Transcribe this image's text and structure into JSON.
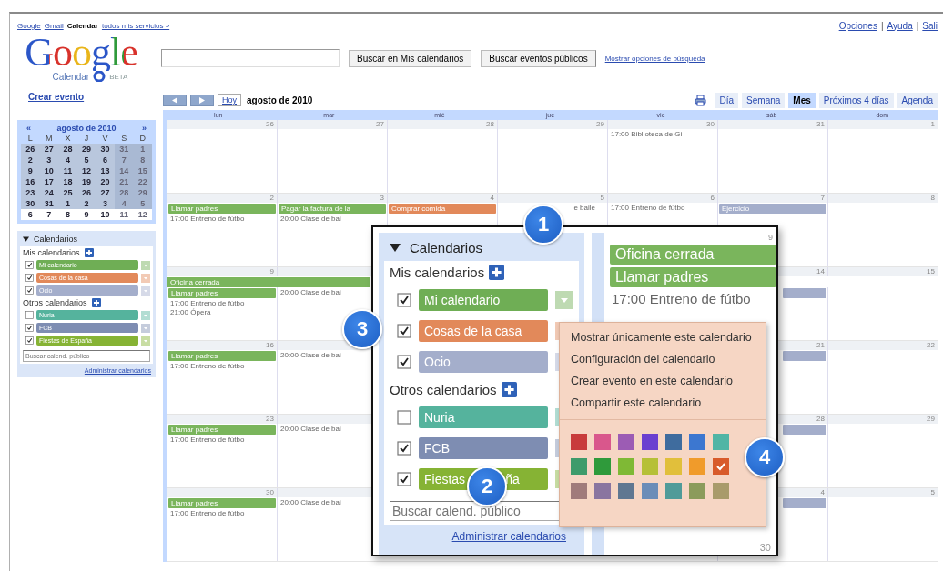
{
  "top_links": {
    "left": [
      {
        "label": "Google",
        "current": false
      },
      {
        "label": "Gmail",
        "current": false
      },
      {
        "label": "Calendar",
        "current": true
      },
      {
        "label": "todos mis servicios »",
        "current": false
      }
    ],
    "right": [
      "Opciones",
      "|",
      "Ayuda",
      "|",
      "Sali"
    ]
  },
  "header": {
    "logo": "Google",
    "logo_sub": "Calendar",
    "logo_badge": "BETA",
    "search_buttons": [
      "Buscar en Mis calendarios",
      "Buscar eventos públicos"
    ],
    "search_options_link": "Mostrar opciones de búsqueda"
  },
  "sidebar": {
    "create_link": "Crear evento",
    "mini_calendar": {
      "prev": "«",
      "title": "agosto de 2010",
      "next": "»",
      "weekdays": [
        "L",
        "M",
        "X",
        "J",
        "V",
        "S",
        "D"
      ],
      "weeks": [
        {
          "selected": true,
          "days": [
            "26",
            "27",
            "28",
            "29",
            "30",
            "31",
            "1"
          ]
        },
        {
          "selected": true,
          "days": [
            "2",
            "3",
            "4",
            "5",
            "6",
            "7",
            "8"
          ]
        },
        {
          "selected": true,
          "days": [
            "9",
            "10",
            "11",
            "12",
            "13",
            "14",
            "15"
          ]
        },
        {
          "selected": true,
          "days": [
            "16",
            "17",
            "18",
            "19",
            "20",
            "21",
            "22"
          ]
        },
        {
          "selected": true,
          "days": [
            "23",
            "24",
            "25",
            "26",
            "27",
            "28",
            "29"
          ]
        },
        {
          "selected": true,
          "days": [
            "30",
            "31",
            "1",
            "2",
            "3",
            "4",
            "5"
          ]
        },
        {
          "selected": false,
          "days": [
            "6",
            "7",
            "8",
            "9",
            "10",
            "11",
            "12"
          ]
        }
      ]
    },
    "calendars": {
      "title": "Calendarios",
      "sections": [
        {
          "title": "Mis calendarios",
          "items": [
            {
              "name": "Mi calendario",
              "color": "#6fae55",
              "checked": true
            },
            {
              "name": "Cosas de la casa",
              "color": "#e2895a",
              "checked": true
            },
            {
              "name": "Ocio",
              "color": "#a4aecb",
              "checked": true
            }
          ]
        },
        {
          "title": "Otros calendarios",
          "items": [
            {
              "name": "Nuria",
              "color": "#55b39d",
              "checked": false
            },
            {
              "name": "FCB",
              "color": "#7e8db2",
              "checked": true
            },
            {
              "name": "Fiestas de España",
              "color": "#86b334",
              "checked": true
            }
          ]
        }
      ],
      "search_placeholder": "Buscar calend. público",
      "manage_link": "Administrar calendarios"
    }
  },
  "toolbar": {
    "today": "Hoy",
    "title": "agosto de 2010",
    "views": [
      {
        "label": "Día",
        "selected": false
      },
      {
        "label": "Semana",
        "selected": false
      },
      {
        "label": "Mes",
        "selected": true
      },
      {
        "label": "Próximos 4 días",
        "selected": false
      },
      {
        "label": "Agenda",
        "selected": false
      }
    ]
  },
  "month": {
    "weekdays": [
      "lun",
      "mar",
      "mié",
      "jue",
      "vie",
      "sáb",
      "dom"
    ],
    "weeks": [
      {
        "days": [
          {
            "number": "26"
          },
          {
            "number": "27"
          },
          {
            "number": "28"
          },
          {
            "number": "29"
          },
          {
            "number": "30",
            "events": [
              {
                "kind": "timed",
                "time": "17:00",
                "title": "Biblioteca de Gi"
              }
            ]
          },
          {
            "number": "31"
          },
          {
            "number": "1"
          }
        ]
      },
      {
        "days": [
          {
            "number": "2",
            "events": [
              {
                "kind": "bar",
                "title": "Llamar padres",
                "color": "#7ab55c"
              },
              {
                "kind": "timed",
                "time": "17:00",
                "title": "Entreno de fútbo"
              }
            ]
          },
          {
            "number": "3",
            "events": [
              {
                "kind": "bar",
                "title": "Pagar la factura de la",
                "color": "#7ab55c"
              },
              {
                "kind": "timed",
                "time": "20:00",
                "title": "Clase de bai"
              }
            ]
          },
          {
            "number": "4",
            "events": [
              {
                "kind": "bar",
                "title": "Comprar comida",
                "color": "#e2895a"
              }
            ]
          },
          {
            "number": "5",
            "events": [
              {
                "kind": "tail",
                "title": "e baile"
              }
            ]
          },
          {
            "number": "6",
            "events": [
              {
                "kind": "timed",
                "time": "17:00",
                "title": "Entreno de fútbo"
              }
            ]
          },
          {
            "number": "7",
            "events": [
              {
                "kind": "bar",
                "title": "Ejercicio",
                "color": "#a4aecb"
              }
            ]
          },
          {
            "number": "8"
          }
        ]
      },
      {
        "banner": {
          "title": "Oficina cerrada",
          "color": "#7ab55c"
        },
        "days": [
          {
            "number": "9",
            "events": [
              {
                "kind": "bar",
                "title": "Llamar padres",
                "color": "#7ab55c"
              },
              {
                "kind": "timed",
                "time": "17:00",
                "title": "Entreno de fútbo"
              },
              {
                "kind": "timed",
                "time": "21:00",
                "title": "Ópera"
              }
            ]
          },
          {
            "events": [
              {
                "kind": "timed",
                "time": "20:00",
                "title": "Clase de bai"
              }
            ]
          }
        ],
        "weekend": [
          {
            "number": "14",
            "events": [
              {
                "kind": "stub",
                "color": "#a4aecb"
              }
            ]
          },
          {
            "number": "15"
          }
        ]
      },
      {
        "days": [
          {
            "number": "16",
            "events": [
              {
                "kind": "bar",
                "title": "Llamar padres",
                "color": "#7ab55c"
              },
              {
                "kind": "timed",
                "time": "17:00",
                "title": "Entreno de fútbo"
              }
            ]
          },
          {
            "events": [
              {
                "kind": "timed",
                "time": "20:00",
                "title": "Clase de bai"
              }
            ]
          }
        ],
        "weekend": [
          {
            "number": "21",
            "events": [
              {
                "kind": "stub",
                "color": "#a4aecb"
              }
            ]
          },
          {
            "number": "22"
          }
        ]
      },
      {
        "days": [
          {
            "number": "23",
            "events": [
              {
                "kind": "bar",
                "title": "Llamar padres",
                "color": "#7ab55c"
              },
              {
                "kind": "timed",
                "time": "17:00",
                "title": "Entreno de fútbo"
              }
            ]
          },
          {
            "events": [
              {
                "kind": "timed",
                "time": "20:00",
                "title": "Clase de bai"
              }
            ]
          }
        ],
        "weekend": [
          {
            "number": "28",
            "events": [
              {
                "kind": "stub",
                "color": "#a4aecb"
              }
            ]
          },
          {
            "number": "29"
          }
        ]
      },
      {
        "days": [
          {
            "number": "30",
            "events": [
              {
                "kind": "bar",
                "title": "Llamar padres",
                "color": "#7ab55c"
              },
              {
                "kind": "timed",
                "time": "17:00",
                "title": "Entreno de fútbo"
              }
            ]
          },
          {
            "events": [
              {
                "kind": "timed",
                "time": "20:00",
                "title": "Clase de bai"
              }
            ]
          }
        ],
        "weekend": [
          {
            "number": "4",
            "events": [
              {
                "kind": "stub",
                "color": "#a4aecb"
              }
            ]
          },
          {
            "number": "5"
          }
        ]
      }
    ]
  },
  "callout": {
    "calendars": {
      "title": "Calendarios",
      "sections": [
        {
          "title": "Mis calendarios",
          "items": [
            {
              "name": "Mi calendario",
              "color": "#6fae55",
              "checked": true
            },
            {
              "name": "Cosas de la casa",
              "color": "#e2895a",
              "checked": true
            },
            {
              "name": "Ocio",
              "color": "#a4aecb",
              "checked": true
            }
          ]
        },
        {
          "title": "Otros calendarios",
          "items": [
            {
              "name": "Nuria",
              "color": "#55b39d",
              "checked": false
            },
            {
              "name": "FCB",
              "color": "#7e8db2",
              "checked": true
            },
            {
              "name": "Fiestas",
              "name_tail": "ña",
              "color": "#86b334",
              "checked": true
            }
          ]
        }
      ],
      "search_placeholder": "Buscar calend. público",
      "manage_link": "Administrar calendarios"
    },
    "day": {
      "number": "9",
      "events": [
        {
          "kind": "bar",
          "title": "Oficina cerrada",
          "color": "#7ab55c"
        },
        {
          "kind": "bar",
          "title": "Llamar padres",
          "color": "#7ab55c"
        },
        {
          "kind": "timed",
          "time": "17:00",
          "title": "Entreno de fútbo"
        }
      ],
      "next_number": "30"
    },
    "menu": {
      "items": [
        "Mostrar únicamente este calendario",
        "Configuración del calendario",
        "Crear evento en este calendario",
        "Compartir este calendario"
      ],
      "swatches": [
        {
          "color": "#c83c3c",
          "selected": false
        },
        {
          "color": "#d9578c",
          "selected": false
        },
        {
          "color": "#9c5cb4",
          "selected": false
        },
        {
          "color": "#6b40d0",
          "selected": false
        },
        {
          "color": "#3f6c9e",
          "selected": false
        },
        {
          "color": "#3c77d0",
          "selected": false
        },
        {
          "color": "#50b5a5",
          "selected": false
        },
        {
          "color": "#3e9b6b",
          "selected": false
        },
        {
          "color": "#2f9a3b",
          "selected": false
        },
        {
          "color": "#7fb935",
          "selected": false
        },
        {
          "color": "#b6c037",
          "selected": false
        },
        {
          "color": "#e1bf3b",
          "selected": false
        },
        {
          "color": "#f09b2b",
          "selected": false
        },
        {
          "color": "#d85b2b",
          "selected": true
        },
        {
          "color": "#a07b7b",
          "selected": false
        },
        {
          "color": "#8a75a0",
          "selected": false
        },
        {
          "color": "#607791",
          "selected": false
        },
        {
          "color": "#6b8db8",
          "selected": false
        },
        {
          "color": "#509b99",
          "selected": false
        },
        {
          "color": "#8b9b5b",
          "selected": false
        },
        {
          "color": "#a99b6b",
          "selected": false
        }
      ]
    },
    "badges": [
      "1",
      "2",
      "3",
      "4"
    ]
  }
}
